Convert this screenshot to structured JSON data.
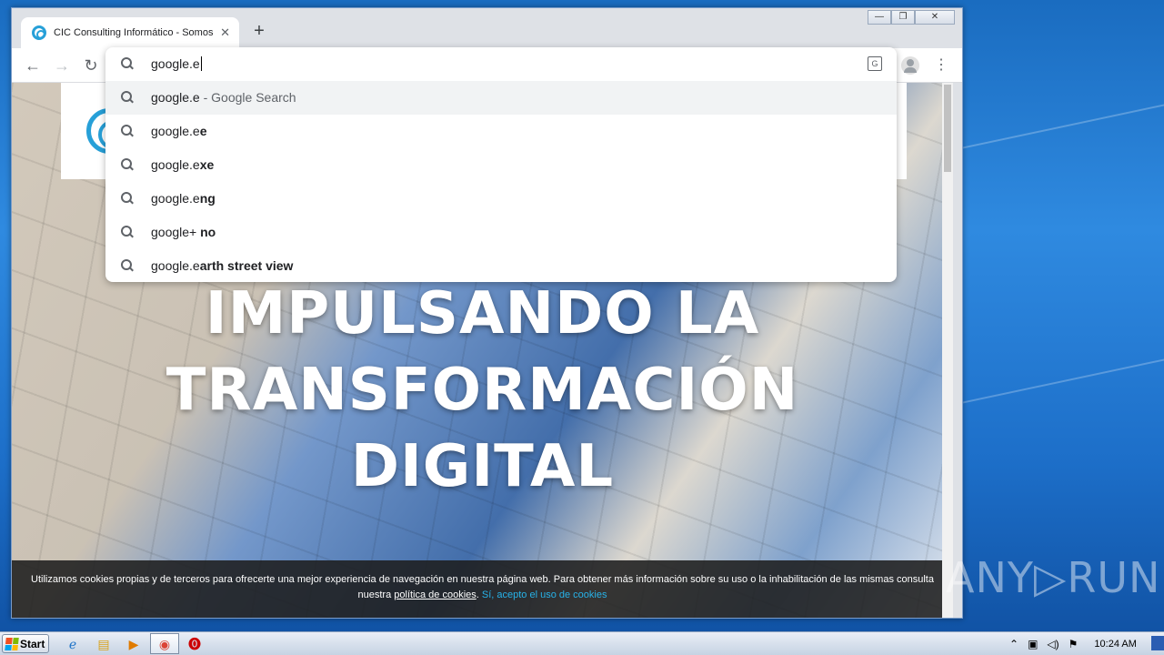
{
  "browser": {
    "tab_title": "CIC Consulting Informático - Somos I",
    "tab_close": "✕",
    "new_tab": "+",
    "window_controls": {
      "minimize": "—",
      "maximize": "❐",
      "close": "✕"
    }
  },
  "omnibox": {
    "query": "google.e",
    "suggestions": [
      {
        "prefix": "google.e",
        "bold": "",
        "suffix": " - Google Search",
        "selected": true
      },
      {
        "prefix": "google.e",
        "bold": "e",
        "suffix": "",
        "selected": false
      },
      {
        "prefix": "google.e",
        "bold": "xe",
        "suffix": "",
        "selected": false
      },
      {
        "prefix": "google.e",
        "bold": "ng",
        "suffix": "",
        "selected": false
      },
      {
        "prefix": "google+ ",
        "bold": "no",
        "suffix": "",
        "selected": false
      },
      {
        "prefix": "google.e",
        "bold": "arth street view",
        "suffix": "",
        "selected": false
      }
    ]
  },
  "page": {
    "hero_lines": [
      "IMPULSANDO LA",
      "TRANSFORMACIÓN",
      "DIGITAL"
    ],
    "cookie": {
      "text": "Utilizamos cookies propias y de terceros para ofrecerte una mejor experiencia de navegación en nuestra página web. Para obtener más información sobre su uso o la inhabilitación de las mismas consulta nuestra ",
      "link": "política de cookies",
      "accept": "Sí, acepto el uso de cookies"
    }
  },
  "taskbar": {
    "start_label": "Start",
    "clock": "10:24 AM"
  },
  "watermark": "ANY▷RUN",
  "colors": {
    "accent": "#27a0d8",
    "cookie_accept": "#27b2e8"
  }
}
